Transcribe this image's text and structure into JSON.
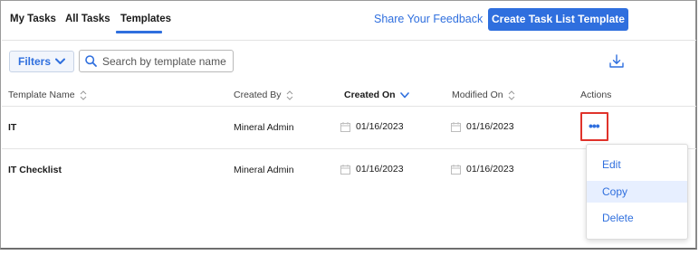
{
  "tabs": [
    {
      "label": "My Tasks"
    },
    {
      "label": "All Tasks"
    },
    {
      "label": "Templates",
      "active": true
    }
  ],
  "header": {
    "feedback_label": "Share Your Feedback",
    "create_button_label": "Create Task List Template"
  },
  "toolbar": {
    "filters_label": "Filters",
    "search_placeholder": "Search by template name",
    "search_value": ""
  },
  "columns": [
    {
      "label": "Template Name",
      "sort": "neutral"
    },
    {
      "label": "Created By",
      "sort": "neutral"
    },
    {
      "label": "Created On",
      "sort": "descending",
      "active": true
    },
    {
      "label": "Modified On",
      "sort": "neutral"
    },
    {
      "label": "Actions"
    }
  ],
  "rows": [
    {
      "name": "IT",
      "created_by": "Mineral Admin",
      "created_on": "01/16/2023",
      "modified_on": "01/16/2023"
    },
    {
      "name": "IT Checklist",
      "created_by": "Mineral Admin",
      "created_on": "01/16/2023",
      "modified_on": "01/16/2023"
    }
  ],
  "actions_menu": {
    "items": [
      {
        "label": "Edit"
      },
      {
        "label": "Copy",
        "hovered": true
      },
      {
        "label": "Delete"
      }
    ]
  },
  "icons": {
    "filters_chevron": "chevron-down-icon",
    "search": "search-icon",
    "download": "download-icon",
    "sort_neutral": "sort-neutral-icon",
    "sort_desc": "chevron-down-icon",
    "calendar": "calendar-icon",
    "actions": "more-horizontal-icon"
  },
  "colors": {
    "accent": "#2f6fde",
    "highlight_box": "#e0332b",
    "menu_hover": "#e7efff"
  }
}
